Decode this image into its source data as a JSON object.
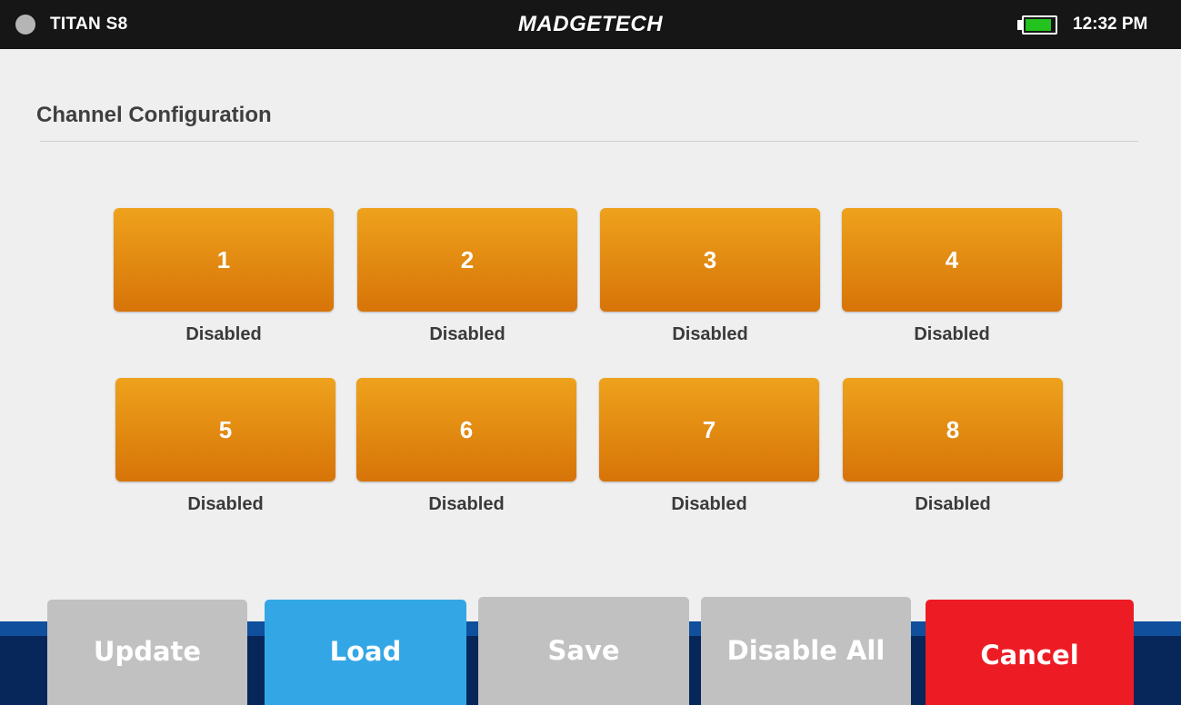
{
  "status_bar": {
    "device_name": "TITAN S8",
    "brand": "MADGETECH",
    "time": "12:32 PM",
    "battery_level": 0.9,
    "battery_color": "#23c21f"
  },
  "page": {
    "title": "Channel Configuration"
  },
  "channels": [
    {
      "number": "1",
      "status": "Disabled"
    },
    {
      "number": "2",
      "status": "Disabled"
    },
    {
      "number": "3",
      "status": "Disabled"
    },
    {
      "number": "4",
      "status": "Disabled"
    },
    {
      "number": "5",
      "status": "Disabled"
    },
    {
      "number": "6",
      "status": "Disabled"
    },
    {
      "number": "7",
      "status": "Disabled"
    },
    {
      "number": "8",
      "status": "Disabled"
    }
  ],
  "colors": {
    "channel_tile": "#e58b10",
    "load": "#33a7e5",
    "cancel": "#ed1c24",
    "inactive_button": "#c1c1c1",
    "nav_band": "#072659"
  },
  "toolbar": {
    "update_label": "Update",
    "load_label": "Load",
    "save_label": "Save",
    "disable_all_label": "Disable All",
    "cancel_label": "Cancel"
  }
}
